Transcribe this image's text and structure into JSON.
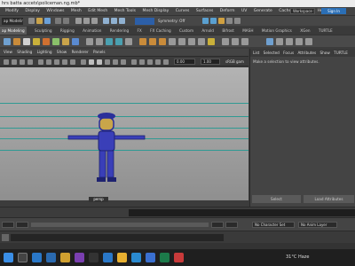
{
  "window": {
    "title": "hrs batta accets\\policeman.ng.mb*"
  },
  "menubar": {
    "items": [
      "Modify",
      "Display",
      "Windows",
      "Mesh",
      "Edit Mesh",
      "Mesh Tools",
      "Mesh Display",
      "Curves",
      "Surfaces",
      "Deform",
      "UV",
      "Generate",
      "Cache",
      "Arnold",
      "Help"
    ],
    "workspace": "Workspace :",
    "sign_in": "Sign In"
  },
  "toolbar": {
    "mode": "ap Modeling",
    "symmetry": "Symmetry: Off",
    "hide_label": "◥"
  },
  "shelf": {
    "tabs": [
      "Sculpting",
      "Rigging",
      "Animation",
      "Rendering",
      "FX",
      "FX Caching",
      "Custom",
      "Arnold",
      "Bifrost",
      "MASH",
      "Motion Graphics",
      "XGen",
      "TURTLE"
    ]
  },
  "viewport": {
    "menu": [
      "View",
      "Shading",
      "Lighting",
      "Show",
      "Renderer",
      "Panels"
    ],
    "field1": "0.00",
    "field2": "1.00",
    "color_space": "sRGB gam",
    "camera_label": "persp"
  },
  "attribute_editor": {
    "tabs": [
      "List",
      "Selected",
      "Focus",
      "Attributes",
      "Show",
      "TURTLE"
    ],
    "message": "Make a selection to view attributes.",
    "buttons": [
      "Select",
      "Load Attributes"
    ]
  },
  "range": {
    "character_set": "No Character Set",
    "anim_layer": "No Anim Layer"
  },
  "taskbar": {
    "temperature": "31°C Haze"
  }
}
